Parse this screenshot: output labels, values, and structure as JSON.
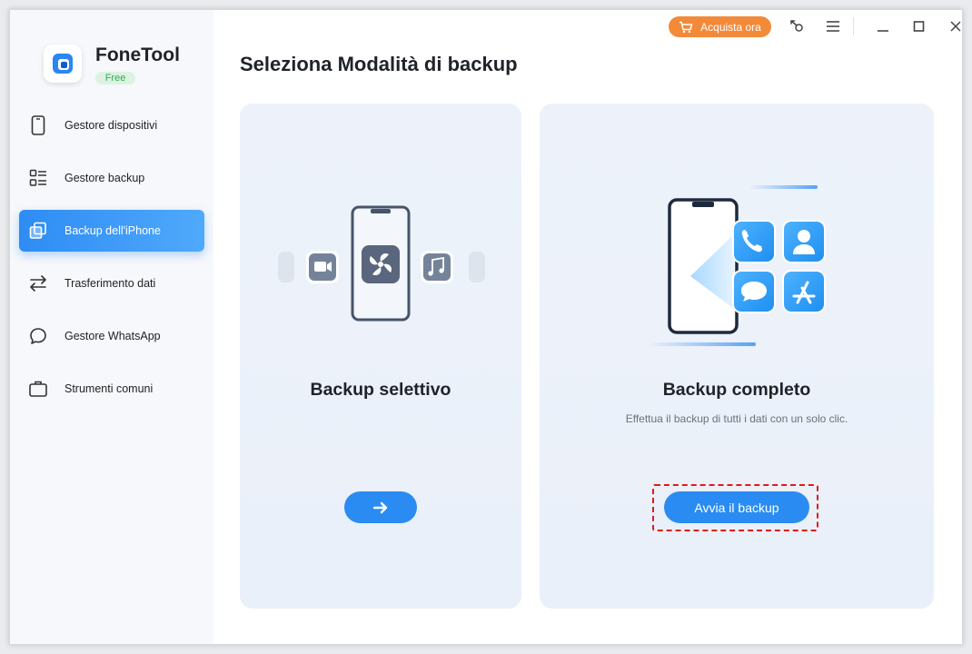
{
  "app": {
    "name": "FoneTool",
    "badge": "Free"
  },
  "sidebar": {
    "items": [
      {
        "label": "Gestore dispositivi",
        "icon": "phone-icon",
        "active": false
      },
      {
        "label": "Gestore backup",
        "icon": "list-icon",
        "active": false
      },
      {
        "label": "Backup dell'iPhone",
        "icon": "copy-icon",
        "active": true
      },
      {
        "label": "Trasferimento dati",
        "icon": "transfer-arrows-icon",
        "active": false
      },
      {
        "label": "Gestore WhatsApp",
        "icon": "chat-bubble-icon",
        "active": false
      },
      {
        "label": "Strumenti comuni",
        "icon": "toolbox-icon",
        "active": false
      }
    ]
  },
  "titlebar": {
    "buy_label": "Acquista ora",
    "icons": [
      "cart-icon",
      "key-icon",
      "menu-icon",
      "minimize-icon",
      "maximize-icon",
      "close-icon"
    ]
  },
  "main": {
    "title": "Seleziona Modalità di backup",
    "cards": [
      {
        "title": "Backup selettivo",
        "description": "",
        "button_icon": "arrow-right-icon"
      },
      {
        "title": "Backup completo",
        "description": "Effettua il backup di tutti i dati con un solo clic.",
        "button_label": "Avvia il backup"
      }
    ]
  },
  "colors": {
    "accent": "#2a8cf2",
    "buy": "#f28a3a",
    "highlight": "#e01b1b",
    "badge_text": "#2eae5a"
  }
}
